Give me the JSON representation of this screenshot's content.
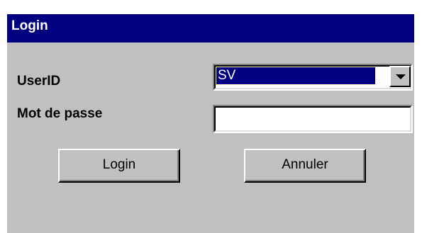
{
  "window": {
    "title": "Login"
  },
  "form": {
    "userid_label": "UserID",
    "userid_value": "SV",
    "password_label": "Mot de passe",
    "password_value": ""
  },
  "buttons": {
    "login": "Login",
    "cancel": "Annuler"
  },
  "colors": {
    "titlebar": "#000080",
    "face": "#c0c0c0",
    "selection": "#000080"
  },
  "icons": {
    "dropdown": "chevron-down-icon"
  }
}
